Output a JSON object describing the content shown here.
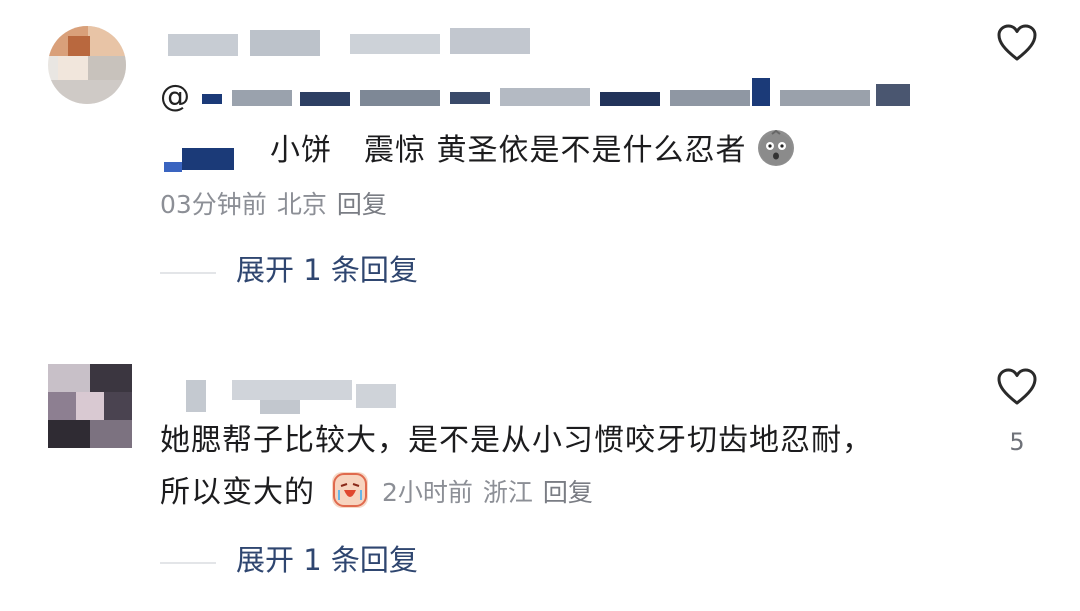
{
  "comments": [
    {
      "mention_prefix": "@",
      "mention_suffix": "小饼",
      "text": "震惊 黄圣依是不是什么忍者",
      "emoji": "ghost-face-emoji",
      "time": "03分钟前",
      "location": "北京",
      "reply_label": "回复",
      "expand_label": "展开 1 条回复",
      "likes": ""
    },
    {
      "text_line1": "她腮帮子比较大，是不是从小习惯咬牙切齿地忍耐，",
      "text_line2": "所以变大的",
      "emoji": "crying-face-emoji",
      "time": "2小时前",
      "location": "浙江",
      "reply_label": "回复",
      "expand_label": "展开 1 条回复",
      "likes": "5"
    }
  ],
  "colors": {
    "expand_text": "#2f4670",
    "meta_text": "#8c8f96",
    "body_text": "#1c1c1e",
    "icon_stroke": "#2a2a2a"
  }
}
